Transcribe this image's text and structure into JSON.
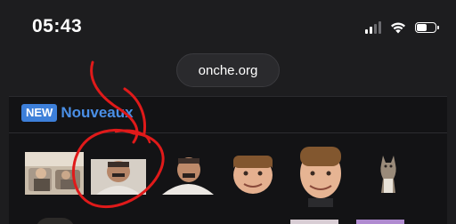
{
  "status_bar": {
    "time": "05:43",
    "icons": [
      "cellular-signal-icon",
      "wifi-icon",
      "battery-icon"
    ]
  },
  "browser": {
    "url": "onche.org"
  },
  "section": {
    "badge": "NEW",
    "title": "Nouveaux"
  },
  "stickers": [
    {
      "name": "sticker-photo-couch"
    },
    {
      "name": "sticker-laughing-man"
    },
    {
      "name": "sticker-laughing-man-2"
    },
    {
      "name": "sticker-bowlcut-face"
    },
    {
      "name": "sticker-bowlcut-face-2"
    },
    {
      "name": "sticker-cat"
    }
  ],
  "colors": {
    "accent": "#3d7fd9",
    "title": "#4a8fe6",
    "scribble": "#e01a1a"
  }
}
